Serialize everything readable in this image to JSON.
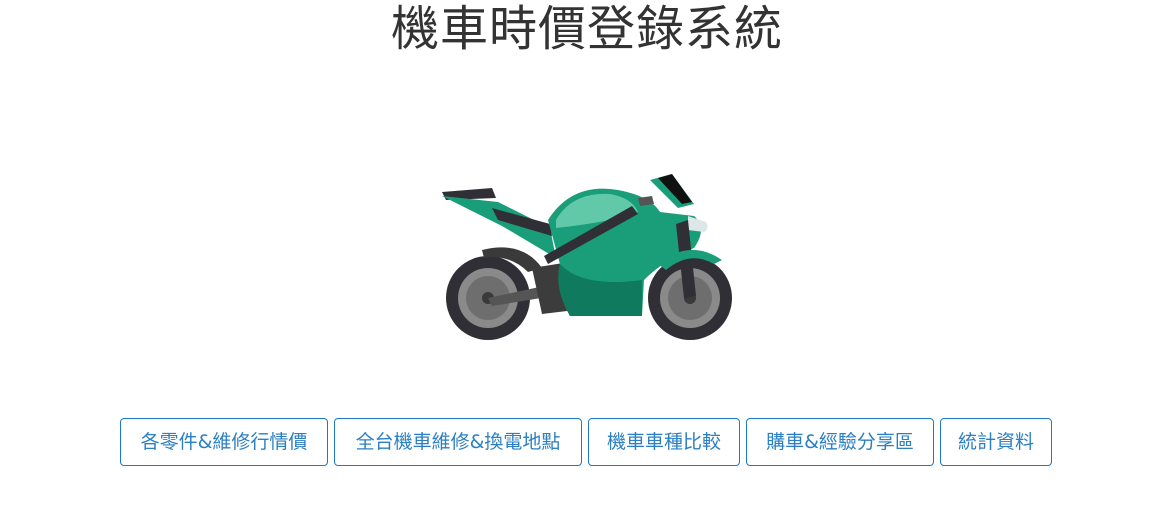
{
  "header": {
    "title": "機車時價登錄系統"
  },
  "hero": {
    "icon": "motorcycle-icon",
    "colors": {
      "body": "#1a9e7a",
      "body_dark": "#0f7a5d",
      "highlight": "#62c9a8",
      "tire": "#2f2f35",
      "rim": "#8a8a8a"
    }
  },
  "nav": {
    "buttons": [
      {
        "label": "各零件&維修行情價"
      },
      {
        "label": "全台機車維修&換電地點"
      },
      {
        "label": "機車車種比較"
      },
      {
        "label": "購車&經驗分享區"
      },
      {
        "label": "統計資料"
      }
    ],
    "accent_color": "#2b7fc3"
  }
}
